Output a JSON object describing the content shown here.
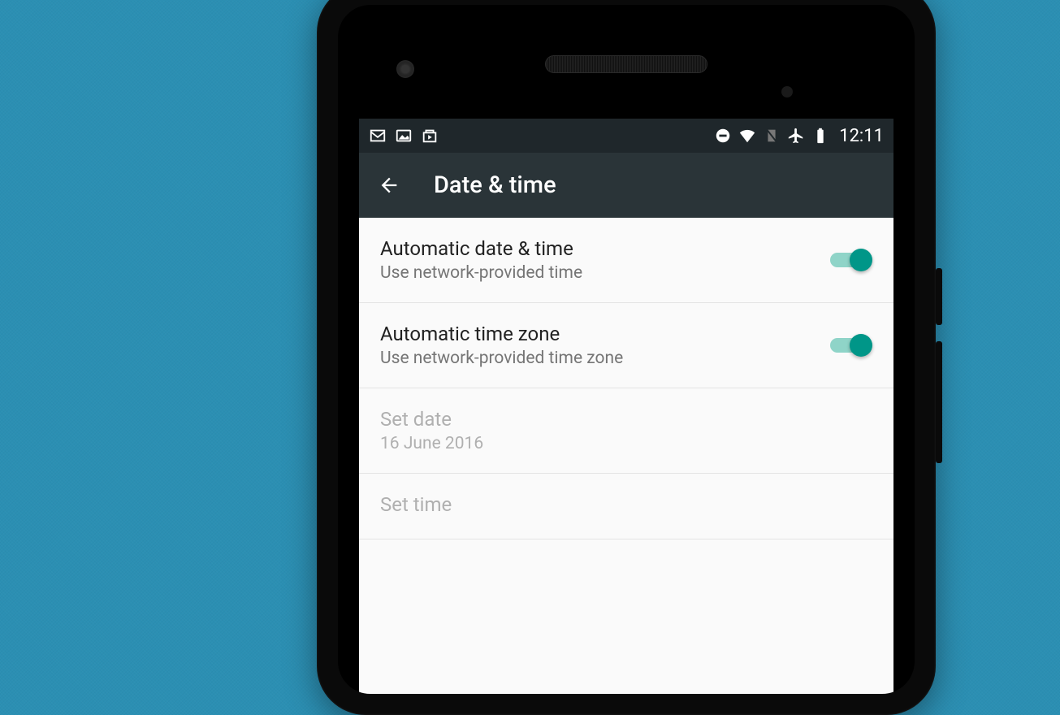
{
  "status_bar": {
    "time": "12:11"
  },
  "app_bar": {
    "title": "Date & time"
  },
  "settings": {
    "auto_date_time": {
      "title": "Automatic date & time",
      "subtitle": "Use network-provided time"
    },
    "auto_time_zone": {
      "title": "Automatic time zone",
      "subtitle": "Use network-provided time zone"
    },
    "set_date": {
      "title": "Set date",
      "subtitle": "16 June 2016"
    },
    "set_time": {
      "title": "Set time"
    }
  }
}
